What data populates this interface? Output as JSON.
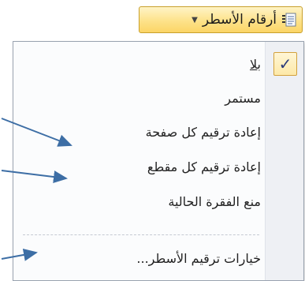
{
  "toolbar": {
    "line_numbers_label": "أرقام الأسطر",
    "icon": "line-numbers-icon",
    "dropdown_icon": "chevron-down-icon"
  },
  "menu": {
    "items": [
      {
        "label": "بلا",
        "checked": true
      },
      {
        "label": "مستمر"
      },
      {
        "label": "إعادة ترقيم كل صفحة"
      },
      {
        "label": "إعادة ترقيم كل مقطع"
      },
      {
        "label": "منع الفقرة الحالية"
      },
      {
        "label": "خيارات ترقيم الأسطر..."
      }
    ],
    "check_glyph": "✓"
  },
  "colors": {
    "button_highlight": "#fde28a",
    "menu_border": "#9aa3b0",
    "arrow": "#3d6ea5"
  }
}
